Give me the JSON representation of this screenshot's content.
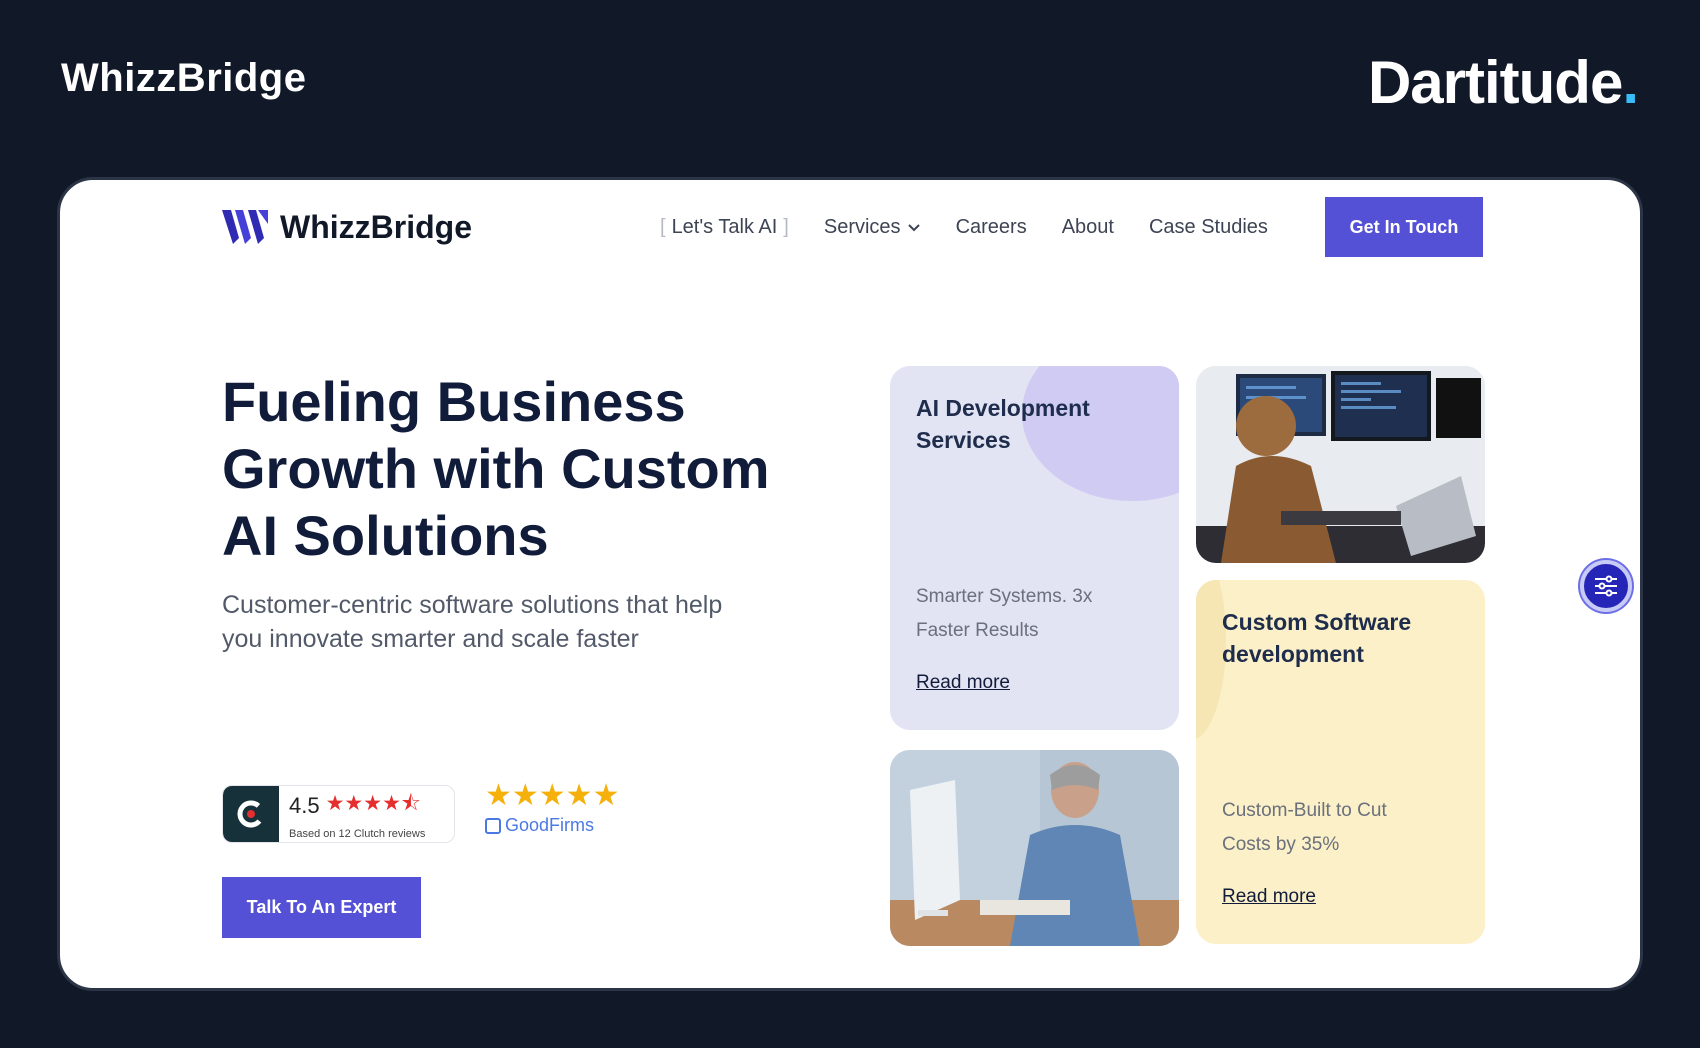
{
  "top": {
    "brand": "WhizzBridge",
    "partner_name": "Dartitude",
    "partner_dot": "."
  },
  "nav": {
    "logo_text": "WhizzBridge",
    "links": [
      {
        "label": "Let's Talk AI"
      },
      {
        "label": "Services"
      },
      {
        "label": "Careers"
      },
      {
        "label": "About"
      },
      {
        "label": "Case Studies"
      }
    ],
    "cta": "Get In Touch"
  },
  "hero": {
    "title": "Fueling Business Growth with Custom AI Solutions",
    "subtitle": "Customer-centric software solutions that help you innovate smarter and scale faster",
    "clutch": {
      "score": "4.5",
      "rating": 4.5,
      "note": "Based on 12 Clutch reviews"
    },
    "goodfirms": {
      "rating": 5,
      "label": "GoodFirms"
    },
    "cta": "Talk To An Expert"
  },
  "tiles": {
    "ai": {
      "title": "AI Development Services",
      "desc": "Smarter Systems. 3x Faster Results",
      "link": "Read more"
    },
    "software": {
      "title": "Custom Software development",
      "desc": "Custom-Built to Cut Costs by 35%",
      "link": "Read more"
    }
  },
  "colors": {
    "accent": "#5551d6",
    "page_bg": "#111827",
    "ai_tile": "#e2e3f3",
    "software_tile": "#fbf0c8",
    "star_red": "#e52e2e",
    "star_gold": "#f5b00b"
  },
  "icons": [
    "whizzbridge-logo-icon",
    "chevron-down-icon",
    "clutch-logo-icon",
    "goodfirms-icon",
    "accessibility-settings-icon"
  ]
}
